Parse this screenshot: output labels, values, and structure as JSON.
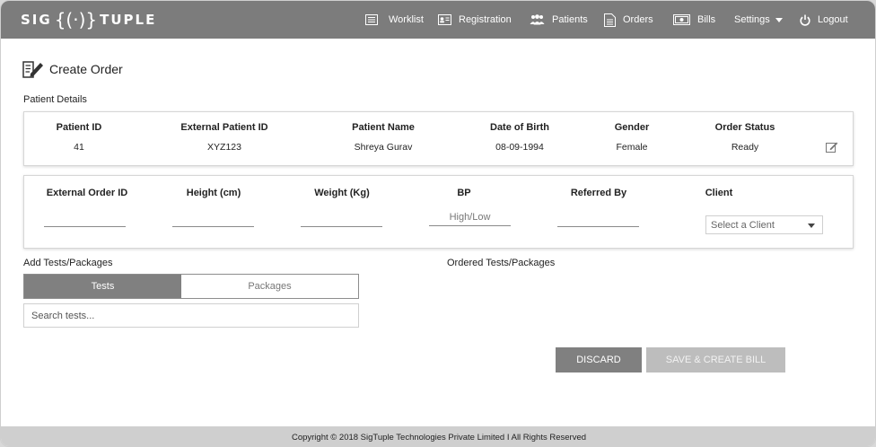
{
  "header": {
    "logo_left": "SIG",
    "logo_mark": "{(·)}",
    "logo_right": "TUPLE",
    "nav": [
      {
        "label": "Worklist",
        "icon": "list-icon"
      },
      {
        "label": "Registration",
        "icon": "id-card-icon"
      },
      {
        "label": "Patients",
        "icon": "users-icon"
      },
      {
        "label": "Orders",
        "icon": "document-icon"
      },
      {
        "label": "Bills",
        "icon": "money-icon"
      },
      {
        "label": "Settings",
        "icon": "caret-down-icon"
      },
      {
        "label": "Logout",
        "icon": "power-icon"
      }
    ]
  },
  "page": {
    "title": "Create Order",
    "patient_details_label": "Patient Details",
    "add_tests_label": "Add Tests/Packages",
    "ordered_label": "Ordered Tests/Packages"
  },
  "patient": {
    "headers": [
      "Patient ID",
      "External Patient ID",
      "Patient Name",
      "Date of Birth",
      "Gender",
      "Order Status"
    ],
    "values": [
      "41",
      "XYZ123",
      "Shreya Gurav",
      "08-09-1994",
      "Female",
      "Ready"
    ]
  },
  "order": {
    "headers": [
      "External Order ID",
      "Height (cm)",
      "Weight (Kg)",
      "BP",
      "Referred By",
      "Client"
    ],
    "bp_placeholder": "High/Low",
    "client_select": "Select a Client"
  },
  "tabs": {
    "tests": "Tests",
    "packages": "Packages"
  },
  "search": {
    "placeholder": "Search tests..."
  },
  "buttons": {
    "discard": "DISCARD",
    "save": "SAVE & CREATE BILL"
  },
  "footer": {
    "text": "Copyright © 2018 SigTuple Technologies Private Limited I All Rights Reserved"
  },
  "colors": {
    "header_bg": "#7c7c7c",
    "active_tab": "#808080",
    "footer_bg": "#cfcfcf"
  }
}
